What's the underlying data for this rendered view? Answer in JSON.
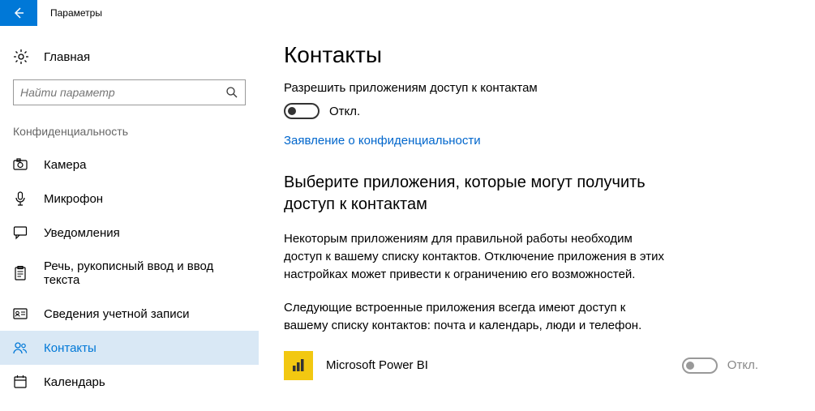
{
  "window": {
    "title": "Параметры"
  },
  "sidebar": {
    "home": "Главная",
    "search_placeholder": "Найти параметр",
    "section": "Конфиденциальность",
    "items": [
      {
        "label": "Камера"
      },
      {
        "label": "Микрофон"
      },
      {
        "label": "Уведомления"
      },
      {
        "label": "Речь, рукописный ввод и ввод текста"
      },
      {
        "label": "Сведения учетной записи"
      },
      {
        "label": "Контакты"
      },
      {
        "label": "Календарь"
      }
    ]
  },
  "main": {
    "title": "Контакты",
    "allow_text": "Разрешить приложениям доступ к контактам",
    "toggle_state": "Откл.",
    "privacy_link": "Заявление о конфиденциальности",
    "section_heading": "Выберите приложения, которые могут получить доступ к контактам",
    "para1": "Некоторым приложениям для правильной работы необходим доступ к вашему списку контактов. Отключение приложения в этих настройках может привести к ограничению его возможностей.",
    "para2": "Следующие встроенные приложения всегда имеют доступ к вашему списку контактов: почта и календарь, люди и телефон.",
    "apps": [
      {
        "name": "Microsoft Power BI",
        "state": "Откл."
      }
    ]
  }
}
